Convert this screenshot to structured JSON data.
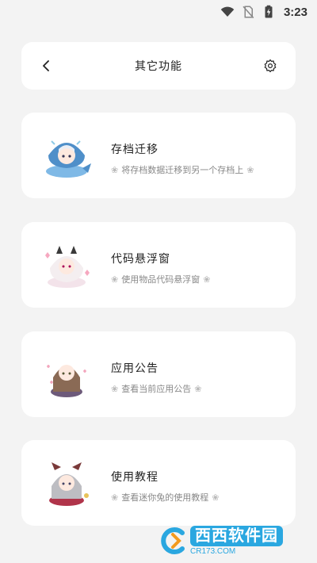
{
  "status_bar": {
    "time": "3:23",
    "icons": [
      "wifi-icon",
      "no-sim-icon",
      "battery-charging-icon"
    ]
  },
  "header": {
    "title": "其它功能",
    "back_icon": "chevron-left-icon",
    "settings_icon": "gear-icon"
  },
  "cards": [
    {
      "title": "存档迁移",
      "desc": "将存档数据迁移到另一个存档上",
      "avatar": "shark-girl-avatar"
    },
    {
      "title": "代码悬浮窗",
      "desc": "使用物品代码悬浮窗",
      "avatar": "cat-girl-avatar"
    },
    {
      "title": "应用公告",
      "desc": "查看当前应用公告",
      "avatar": "brown-hair-girl-avatar"
    },
    {
      "title": "使用教程",
      "desc": "查看迷你兔的使用教程",
      "avatar": "gray-hair-girl-avatar"
    }
  ],
  "decor": {
    "flower": "❀"
  },
  "watermark": {
    "main": "西西软件园",
    "sub": "CR173.COM"
  },
  "colors": {
    "background": "#f3f3f3",
    "card": "#ffffff",
    "accent": "#2aa7e0"
  }
}
